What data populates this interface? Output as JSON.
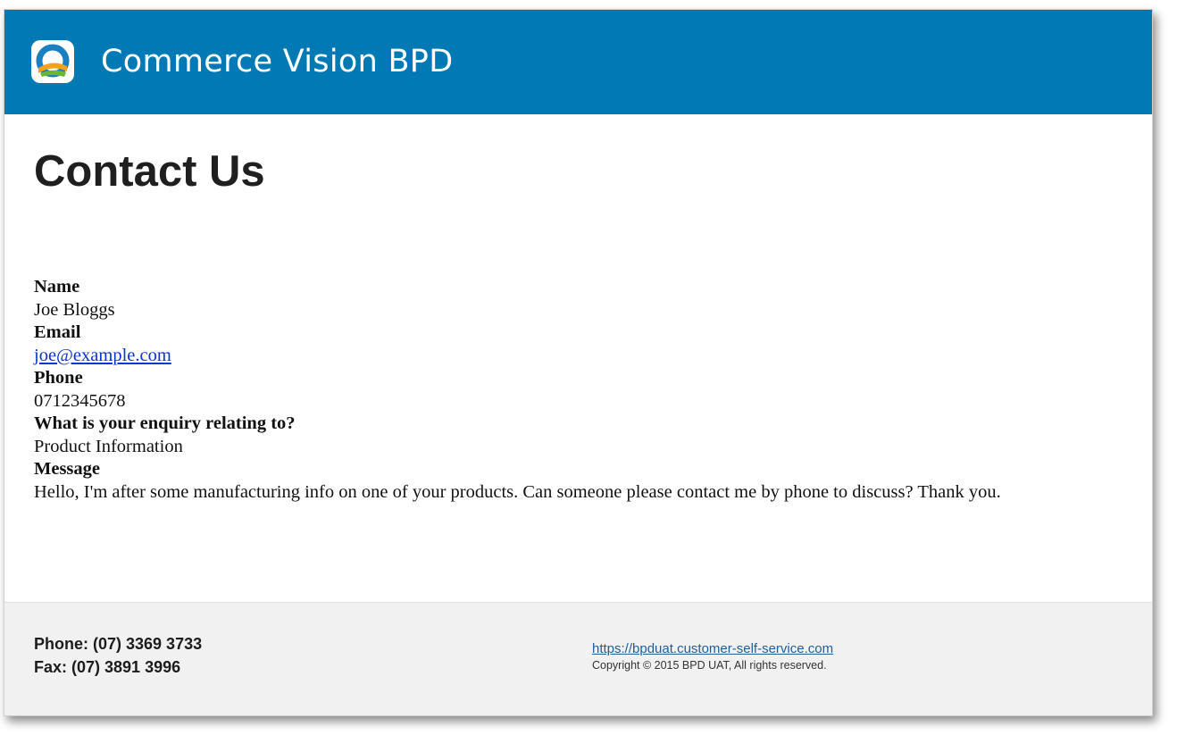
{
  "header": {
    "brand": "Commerce Vision BPD",
    "logo_icon": "commerce-vision-logo"
  },
  "page": {
    "title": "Contact Us"
  },
  "fields": [
    {
      "label": "Name",
      "value": "Joe Bloggs"
    },
    {
      "label": "Email",
      "value": "joe@example.com"
    },
    {
      "label": "Phone",
      "value": "0712345678"
    },
    {
      "label": "What is your enquiry relating to?",
      "value": "Product Information"
    },
    {
      "label": "Message",
      "value": "Hello, I'm after some manufacturing info on one of your products. Can someone please contact me by phone to discuss? Thank you."
    }
  ],
  "footer": {
    "phone": "Phone: (07) 3369 3733",
    "fax": "Fax: (07) 3891 3996",
    "website": "https://bpduat.customer-self-service.com",
    "copyright": "Copyright © 2015 BPD UAT, All rights reserved."
  },
  "colors": {
    "header_bg": "#0079b4",
    "footer_bg": "#f1f1f1",
    "link": "#0a33d6"
  }
}
